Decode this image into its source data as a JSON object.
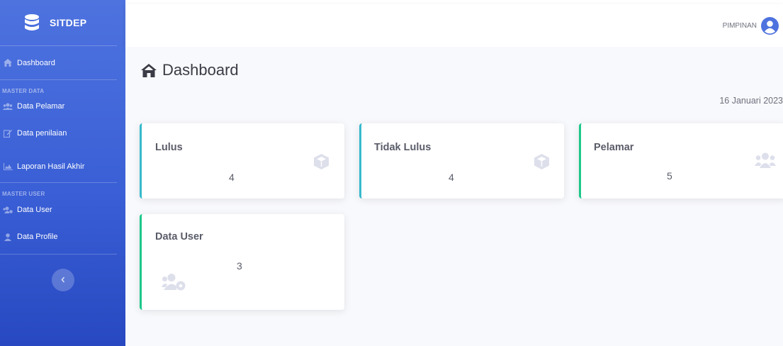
{
  "sidebar": {
    "brand": "SITDEP",
    "items": [
      {
        "label": "Dashboard",
        "icon": "home-icon"
      },
      {
        "label": "Data Pelamar",
        "icon": "users-icon"
      },
      {
        "label": "Data penilaian",
        "icon": "edit-icon"
      },
      {
        "label": "Laporan Hasil Akhir",
        "icon": "chart-area-icon"
      },
      {
        "label": "Data User",
        "icon": "users-cog-icon"
      },
      {
        "label": "Data Profile",
        "icon": "user-icon"
      }
    ],
    "headings": [
      "MASTER DATA",
      "MASTER USER"
    ],
    "toggle_icon": "chevron-left-icon"
  },
  "topbar": {
    "user_name": "PIMPINAN",
    "avatar_icon": "user-circle-icon"
  },
  "main": {
    "title": "Dashboard",
    "date": "16 Januari 2023",
    "cards": [
      {
        "title": "Lulus",
        "value": "4",
        "icon": "box-icon",
        "color": "#36b9cc"
      },
      {
        "title": "Tidak Lulus",
        "value": "4",
        "icon": "box-icon",
        "color": "#36b9cc"
      },
      {
        "title": "Pelamar",
        "value": "5",
        "icon": "users-icon",
        "color": "#1cc88a"
      },
      {
        "title": "Data User",
        "value": "3",
        "icon": "users-cog-icon",
        "color": "#1cc88a"
      }
    ]
  },
  "colors": {
    "primary": "#4e73df",
    "info": "#36b9cc",
    "success": "#1cc88a"
  }
}
